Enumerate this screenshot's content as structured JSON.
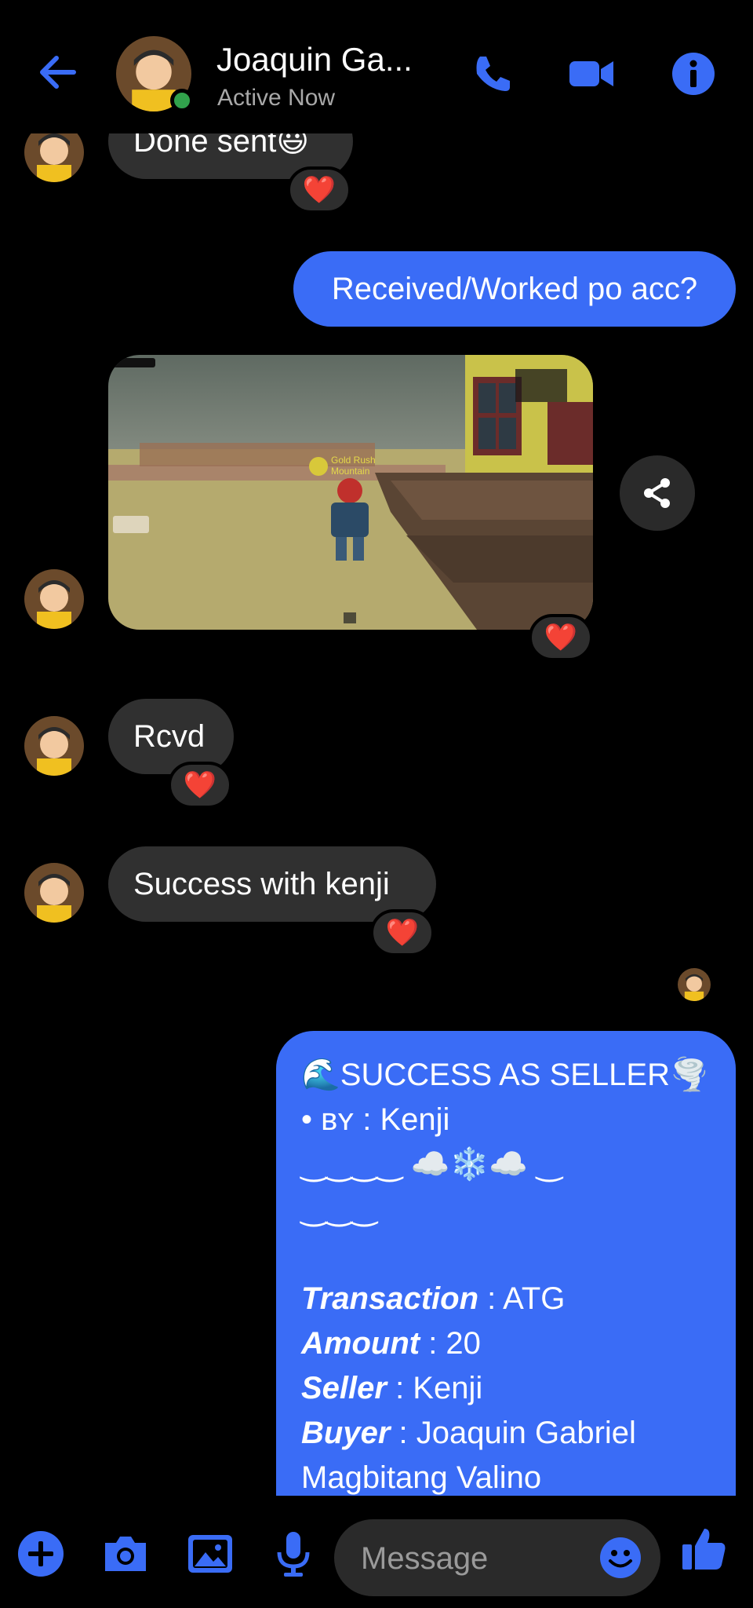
{
  "header": {
    "name": "Joaquin Ga...",
    "status": "Active Now"
  },
  "messages": {
    "m1": "Done sent😃",
    "m2": "Received/Worked po acc?",
    "m3": "Rcvd",
    "m4": "Success with kenji",
    "reaction": "❤️"
  },
  "photo_overlay": {
    "sign_text": "Gold Rush",
    "sign_sub": "Mountain"
  },
  "receipt": {
    "line1": "🌊SUCCESS AS SELLER🌪️",
    "line2_prefix": "• ʙʏ",
    "line2_value": " : Kenji",
    "line3": "‿‿‿‿ ☁️❄️☁️ ‿",
    "line4": "‿‿‿",
    "transaction_label": "Transaction",
    "transaction_value": " : ATG",
    "amount_label": "Amount",
    "amount_value": " : 20",
    "seller_label": "Seller",
    "seller_value": " : Kenji",
    "buyer_label": "Buyer",
    "buyer_value": " : Joaquin Gabriel",
    "buyer_value2": "Magbitang Valino"
  },
  "composer": {
    "placeholder": "Message"
  },
  "colors": {
    "accent": "#3a6cf6",
    "incoming_bubble": "#303030",
    "online": "#31a24c"
  },
  "icons": [
    "back-arrow-icon",
    "phone-icon",
    "video-camera-icon",
    "info-icon",
    "share-icon",
    "plus-icon",
    "camera-icon",
    "image-icon",
    "microphone-icon",
    "emoji-icon",
    "thumbs-up-icon"
  ]
}
